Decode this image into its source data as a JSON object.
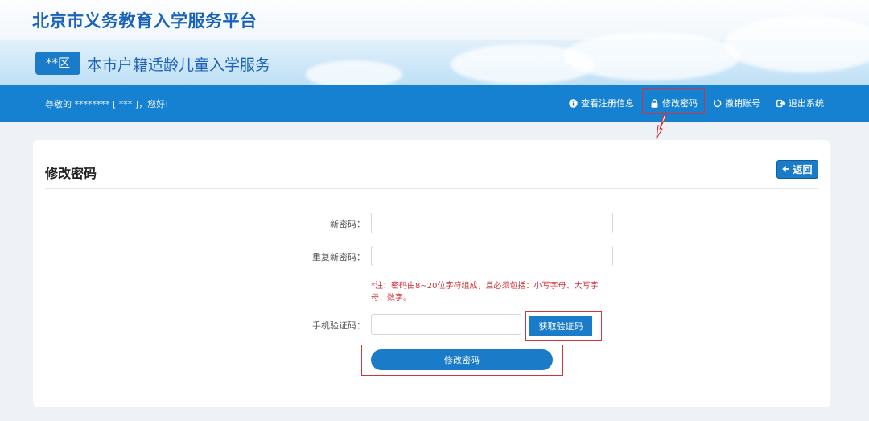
{
  "header": {
    "platform_title": "北京市义务教育入学服务平台",
    "district_badge": "**区",
    "service_title": "本市户籍适龄儿童入学服务"
  },
  "navbar": {
    "greeting": "尊敬的 ******** [ *** ]，您好!",
    "items": [
      {
        "label": "查看注册信息",
        "icon": "info-icon"
      },
      {
        "label": "修改密码",
        "icon": "lock-icon"
      },
      {
        "label": "撤销账号",
        "icon": "refresh-icon"
      },
      {
        "label": "退出系统",
        "icon": "logout-icon"
      }
    ]
  },
  "card": {
    "title": "修改密码",
    "back_label": "返回"
  },
  "form": {
    "new_password_label": "新密码：",
    "new_password_value": "",
    "repeat_password_label": "重复新密码：",
    "repeat_password_value": "",
    "note": "*注：密码由8~20位字符组成，且必须包括：小写字母、大写字母、数字。",
    "sms_code_label": "手机验证码：",
    "sms_code_value": "",
    "get_code_label": "获取验证码",
    "submit_label": "修改密码"
  },
  "colors": {
    "primary": "#1581d0",
    "title_blue": "#1a63b8",
    "annotation_red": "#d2333c"
  }
}
